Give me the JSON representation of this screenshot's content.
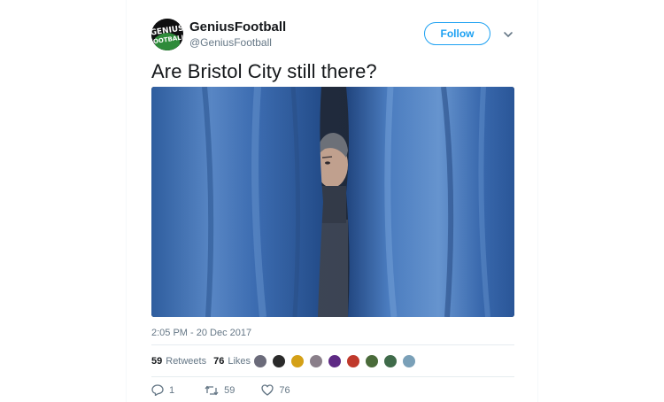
{
  "user": {
    "display_name": "GeniusFootball",
    "handle": "@GeniusFootball",
    "avatar_text": "GENIUS FOOTBALL"
  },
  "follow_label": "Follow",
  "tweet": {
    "text": "Are Bristol City still there?",
    "timestamp": "2:05 PM - 20 Dec 2017"
  },
  "stats": {
    "retweets_count": "59",
    "retweets_label": "Retweets",
    "likes_count": "76",
    "likes_label": "Likes"
  },
  "likers": [
    "#6b6b7a",
    "#2a2a2a",
    "#d4a017",
    "#8a7f8a",
    "#5e2a84",
    "#c0392b",
    "#4a6b3a",
    "#3f6b4a",
    "#7aa0b8"
  ],
  "actions": {
    "reply_count": "1",
    "retweet_count": "59",
    "like_count": "76"
  },
  "colors": {
    "accent": "#1da1f2",
    "text": "#14171a",
    "muted": "#657786",
    "curtain": "#3f6fae"
  }
}
